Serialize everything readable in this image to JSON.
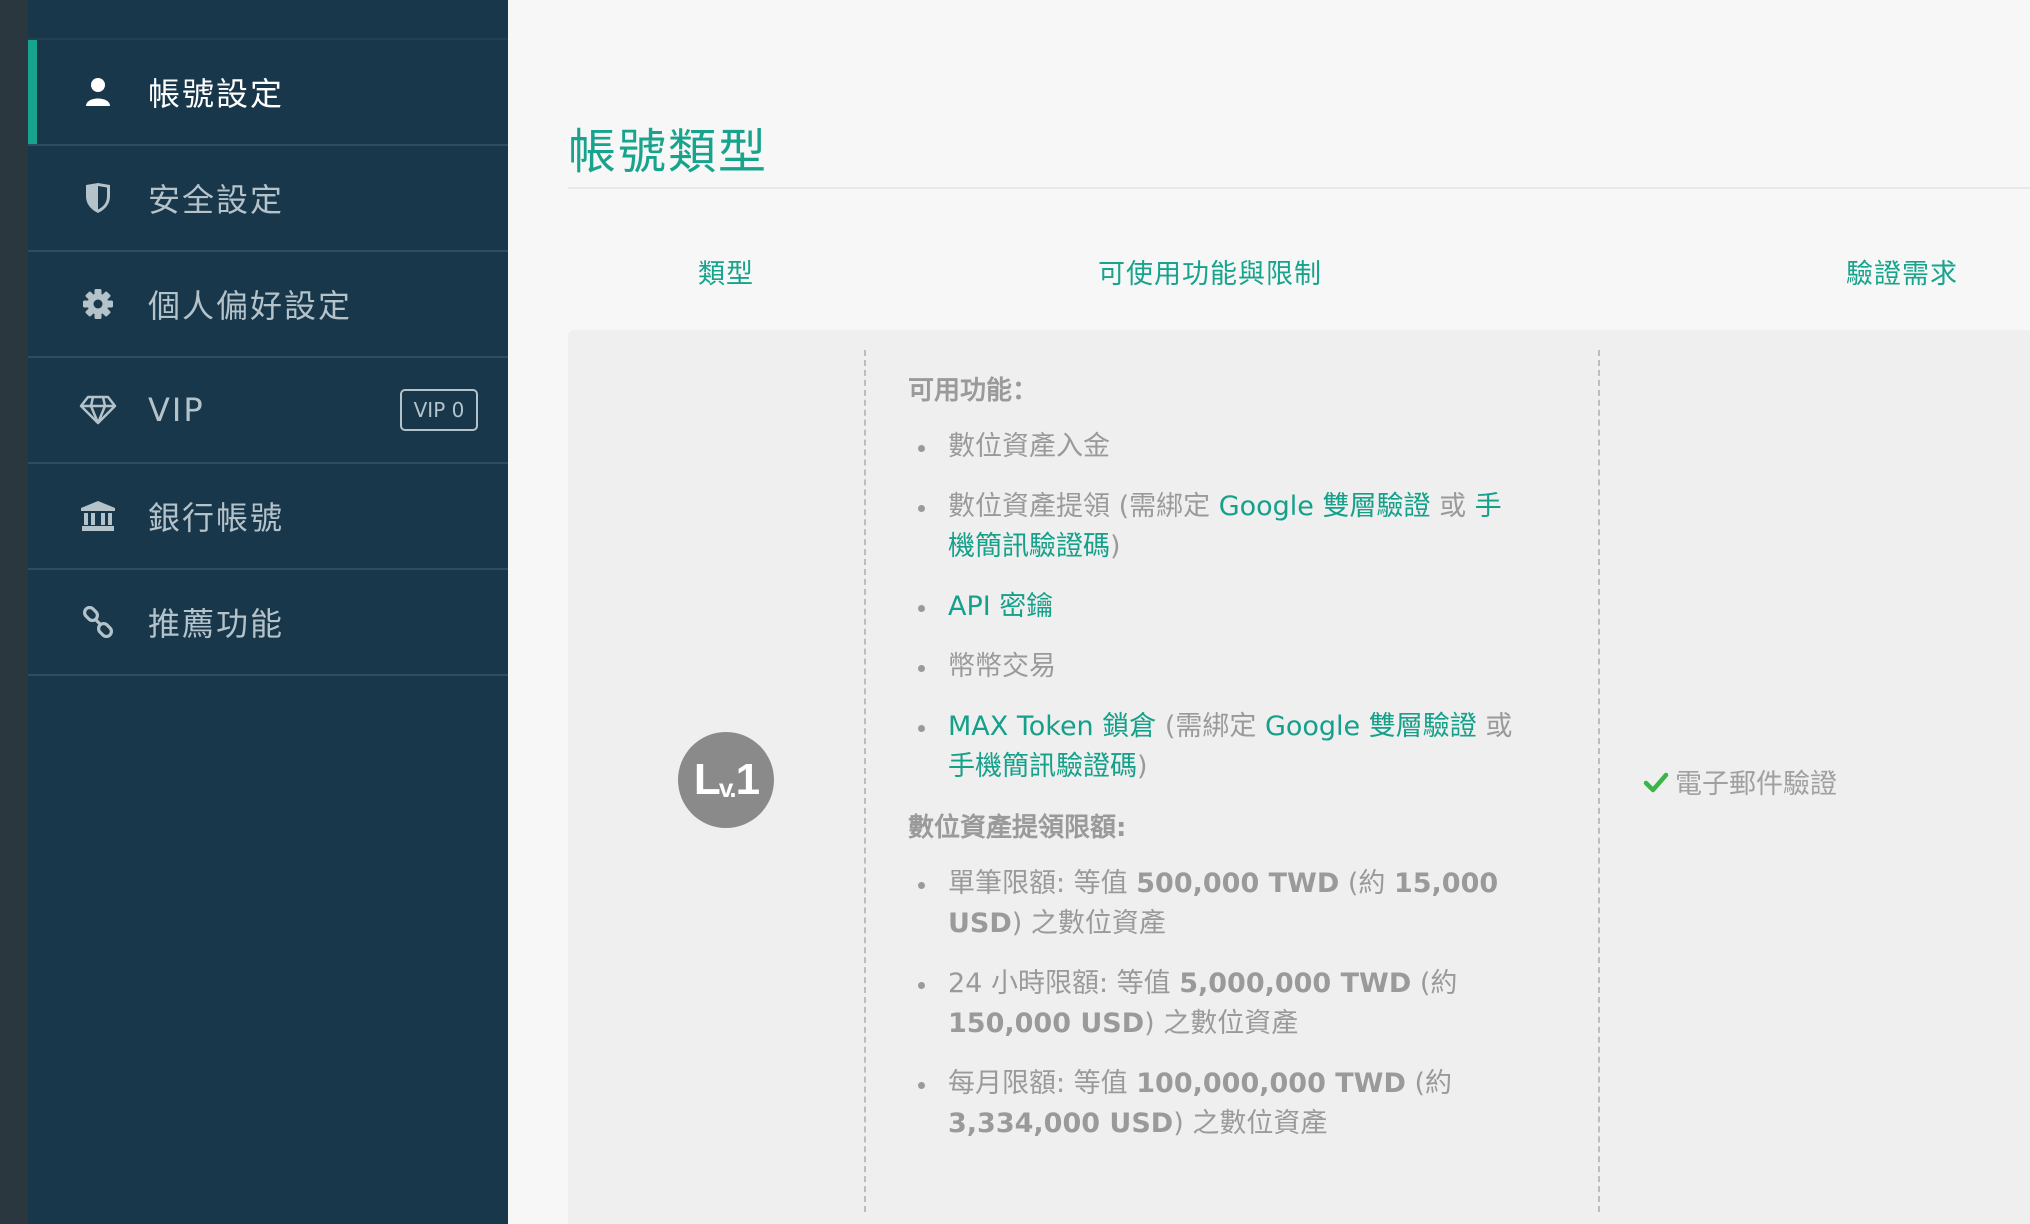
{
  "sidebar": {
    "items": [
      {
        "label": "帳號設定",
        "icon": "user-icon"
      },
      {
        "label": "安全設定",
        "icon": "shield-icon"
      },
      {
        "label": "個人偏好設定",
        "icon": "gear-icon"
      },
      {
        "label": "VIP",
        "icon": "diamond-icon",
        "badge": "VIP 0"
      },
      {
        "label": "銀行帳號",
        "icon": "bank-icon"
      },
      {
        "label": "推薦功能",
        "icon": "link-icon"
      }
    ],
    "active_index": 0
  },
  "main": {
    "title": "帳號類型",
    "columns": [
      "類型",
      "可使用功能與限制",
      "驗證需求"
    ],
    "level": {
      "badge_main": "L",
      "badge_sub": "v.",
      "badge_num": "1",
      "features_title": "可用功能：",
      "f1": "數位資產入金",
      "f2_a": "數位資產提領 (需綁定 ",
      "f2_b": "Google 雙層驗證",
      "f2_c": " 或 ",
      "f2_d": "手機簡訊驗證碼",
      "f2_e": ")",
      "f3": "API 密鑰",
      "f4": "幣幣交易",
      "f5_a": "MAX Token 鎖倉",
      "f5_b": " (需綁定 ",
      "f5_c": "Google 雙層驗證",
      "f5_d": " 或 ",
      "f5_e": "手機簡訊驗證碼",
      "f5_f": ")",
      "limits_title": "數位資產提領限額:",
      "l1_a": "單筆限額: 等值 ",
      "l1_b": "500,000 TWD",
      "l1_c": " (約 ",
      "l1_d": "15,000 USD",
      "l1_e": ") 之數位資產",
      "l2_a": "24 小時限額: 等值 ",
      "l2_b": "5,000,000 TWD",
      "l2_c": " (約 ",
      "l2_d": "150,000 USD",
      "l2_e": ") 之數位資產",
      "l3_a": "每月限額: 等值 ",
      "l3_b": "100,000,000 TWD",
      "l3_c": " (約 ",
      "l3_d": "3,334,000 USD",
      "l3_e": ") 之數位資產",
      "verification": "電子郵件驗證"
    }
  },
  "colors": {
    "sidebar_bg": "#18374a",
    "accent": "#17a38c",
    "check": "#3bb54a"
  }
}
